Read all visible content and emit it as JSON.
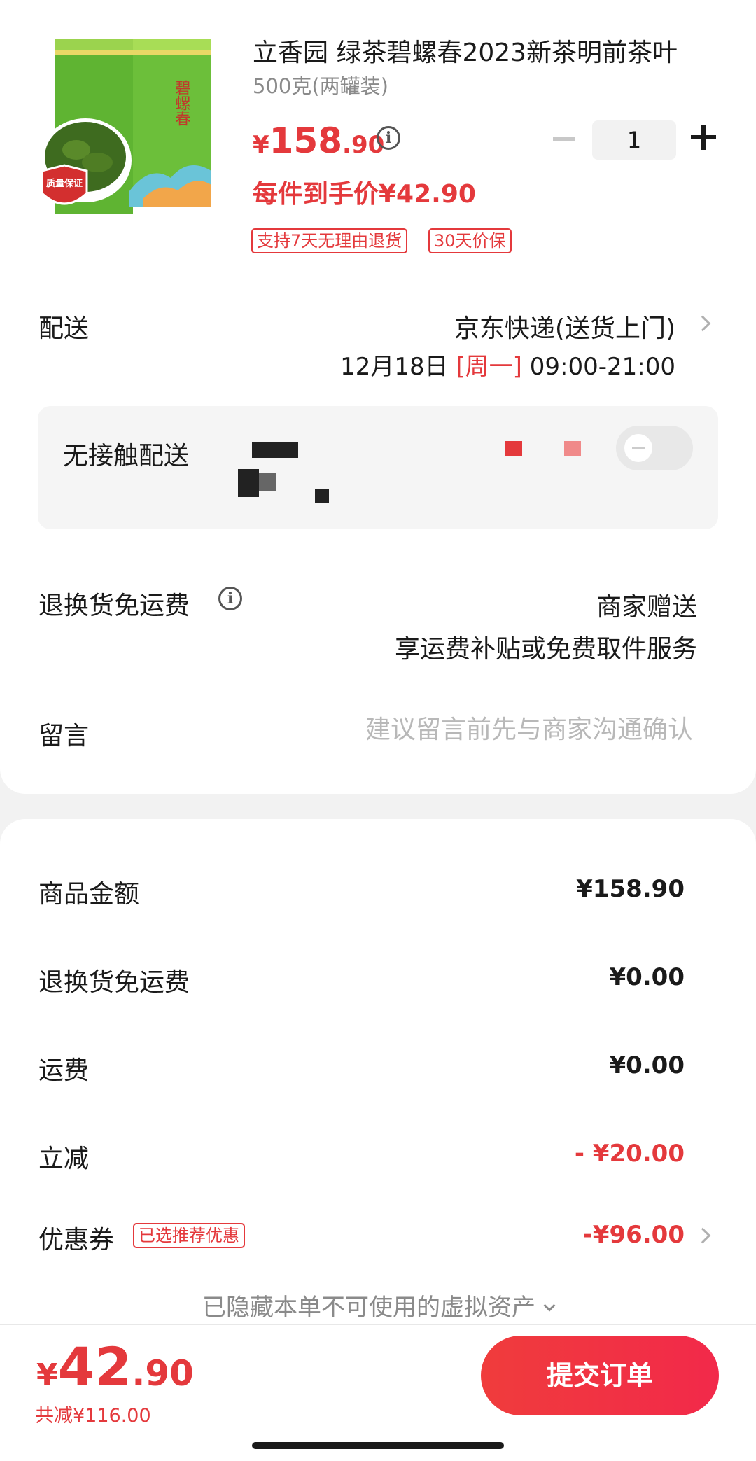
{
  "product": {
    "title": "立香园 绿茶碧螺春2023新茶明前茶叶",
    "spec": "500克(两罐装)",
    "price_symbol": "¥",
    "price_int": "158",
    "price_dec": ".90",
    "unit_price": "每件到手价¥42.90",
    "tags": [
      "支持7天无理由退货",
      "30天价保"
    ],
    "quantity": "1",
    "package_text": "碧螺春",
    "badge_text": "质量保证"
  },
  "delivery": {
    "label": "配送",
    "method": "京东快递(送货上门)",
    "date": "12月18日",
    "weekday": "[周一]",
    "time": "09:00-21:00"
  },
  "contactless": {
    "label": "无接触配送"
  },
  "return_shipping": {
    "label": "退换货免运费",
    "value1": "商家赠送",
    "value2": "享运费补贴或免费取件服务"
  },
  "note": {
    "label": "留言",
    "placeholder": "建议留言前先与商家沟通确认"
  },
  "summary": {
    "rows": [
      {
        "label": "商品金额",
        "value": "¥158.90"
      },
      {
        "label": "退换货免运费",
        "value": "¥0.00"
      },
      {
        "label": "运费",
        "value": "¥0.00"
      },
      {
        "label": "立减",
        "value": "- ¥20.00"
      },
      {
        "label": "优惠券",
        "value": "-¥96.00"
      }
    ],
    "coupon_tag": "已选推荐优惠",
    "hidden_assets": "已隐藏本单不可使用的虚拟资产"
  },
  "footer": {
    "total_symbol": "¥",
    "total_int": "42",
    "total_dec": ".90",
    "saved": "共减¥116.00",
    "submit_label": "提交订单"
  },
  "colors": {
    "accent": "#e4393c",
    "tea_green": "#7dc242"
  }
}
